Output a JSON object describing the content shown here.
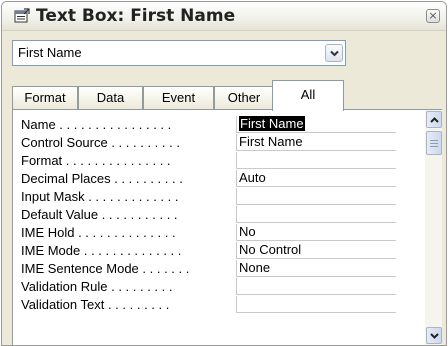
{
  "window": {
    "title": "Text Box: First Name",
    "close_label": "×"
  },
  "object_selector": {
    "value": "First Name"
  },
  "tabs": [
    {
      "label": "Format"
    },
    {
      "label": "Data"
    },
    {
      "label": "Event"
    },
    {
      "label": "Other"
    },
    {
      "label": "All",
      "active": true
    }
  ],
  "properties": [
    {
      "label": "Name . . . . . . . . . . . . . . . .",
      "value": "First Name",
      "selected": true
    },
    {
      "label": "Control Source . . . . . . . . . .",
      "value": "First Name"
    },
    {
      "label": "Format . . . . . . . . . . . . . . .",
      "value": ""
    },
    {
      "label": "Decimal Places . . . . . . . . . .",
      "value": "Auto"
    },
    {
      "label": "Input Mask . . . . . . . . . . . . .",
      "value": ""
    },
    {
      "label": "Default Value . . . . . . . . . . .",
      "value": ""
    },
    {
      "label": "IME Hold . . . . . . . . . . . . . .",
      "value": "No"
    },
    {
      "label": "IME Mode . . . . . . . . . . . . . .",
      "value": "No Control"
    },
    {
      "label": "IME Sentence Mode . . . . . . .",
      "value": "None"
    },
    {
      "label": "Validation Rule . . . . . . . . .",
      "value": ""
    },
    {
      "label": "Validation Text . . . . . . . . .",
      "value": ""
    }
  ],
  "icons": {
    "title": "properties-sheet-icon",
    "dropdown": "chevron-down-icon",
    "scroll_up": "arrow-up-icon",
    "scroll_down": "arrow-down-icon"
  }
}
